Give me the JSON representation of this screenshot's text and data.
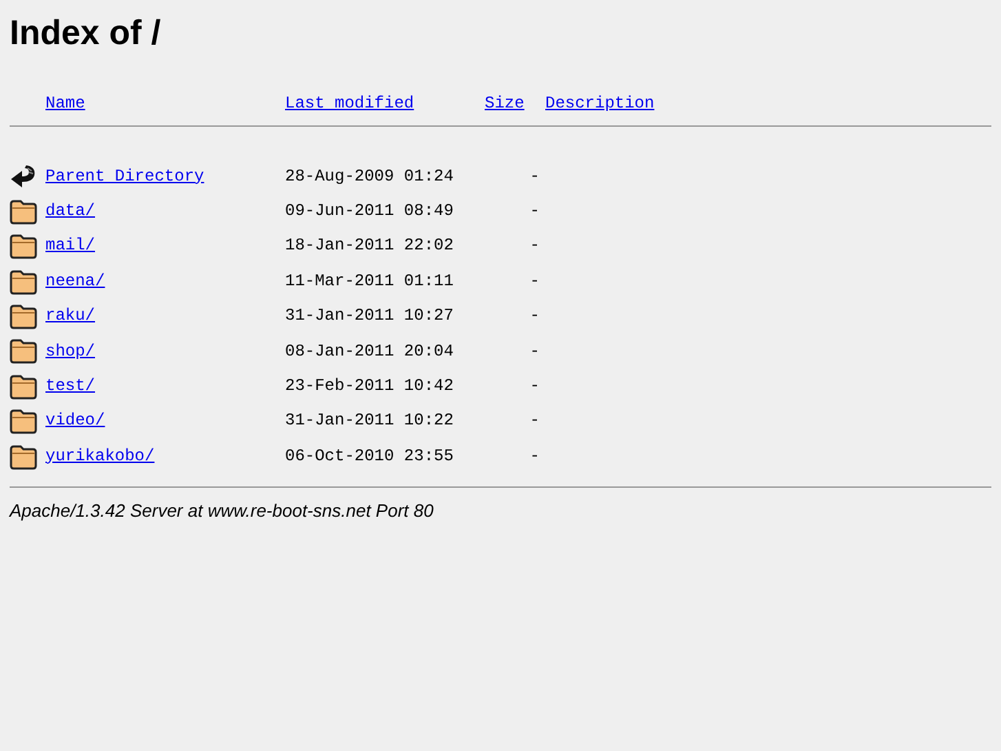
{
  "title": "Index of /",
  "columns": [
    {
      "label": "Name"
    },
    {
      "label": "Last modified"
    },
    {
      "label": "Size"
    },
    {
      "label": "Description"
    }
  ],
  "rows": [
    {
      "kind": "parent",
      "name": "Parent Directory",
      "modified": "28-Aug-2009 01:24",
      "size": "-"
    },
    {
      "kind": "folder",
      "name": "data/",
      "modified": "09-Jun-2011 08:49",
      "size": "-"
    },
    {
      "kind": "folder",
      "name": "mail/",
      "modified": "18-Jan-2011 22:02",
      "size": "-"
    },
    {
      "kind": "folder",
      "name": "neena/",
      "modified": "11-Mar-2011 01:11",
      "size": "-"
    },
    {
      "kind": "folder",
      "name": "raku/",
      "modified": "31-Jan-2011 10:27",
      "size": "-"
    },
    {
      "kind": "folder",
      "name": "shop/",
      "modified": "08-Jan-2011 20:04",
      "size": "-"
    },
    {
      "kind": "folder",
      "name": "test/",
      "modified": "23-Feb-2011 10:42",
      "size": "-"
    },
    {
      "kind": "folder",
      "name": "video/",
      "modified": "31-Jan-2011 10:22",
      "size": "-"
    },
    {
      "kind": "folder",
      "name": "yurikakobo/",
      "modified": "06-Oct-2010 23:55",
      "size": "-"
    }
  ],
  "address": "Apache/1.3.42 Server at www.re-boot-sns.net Port 80"
}
